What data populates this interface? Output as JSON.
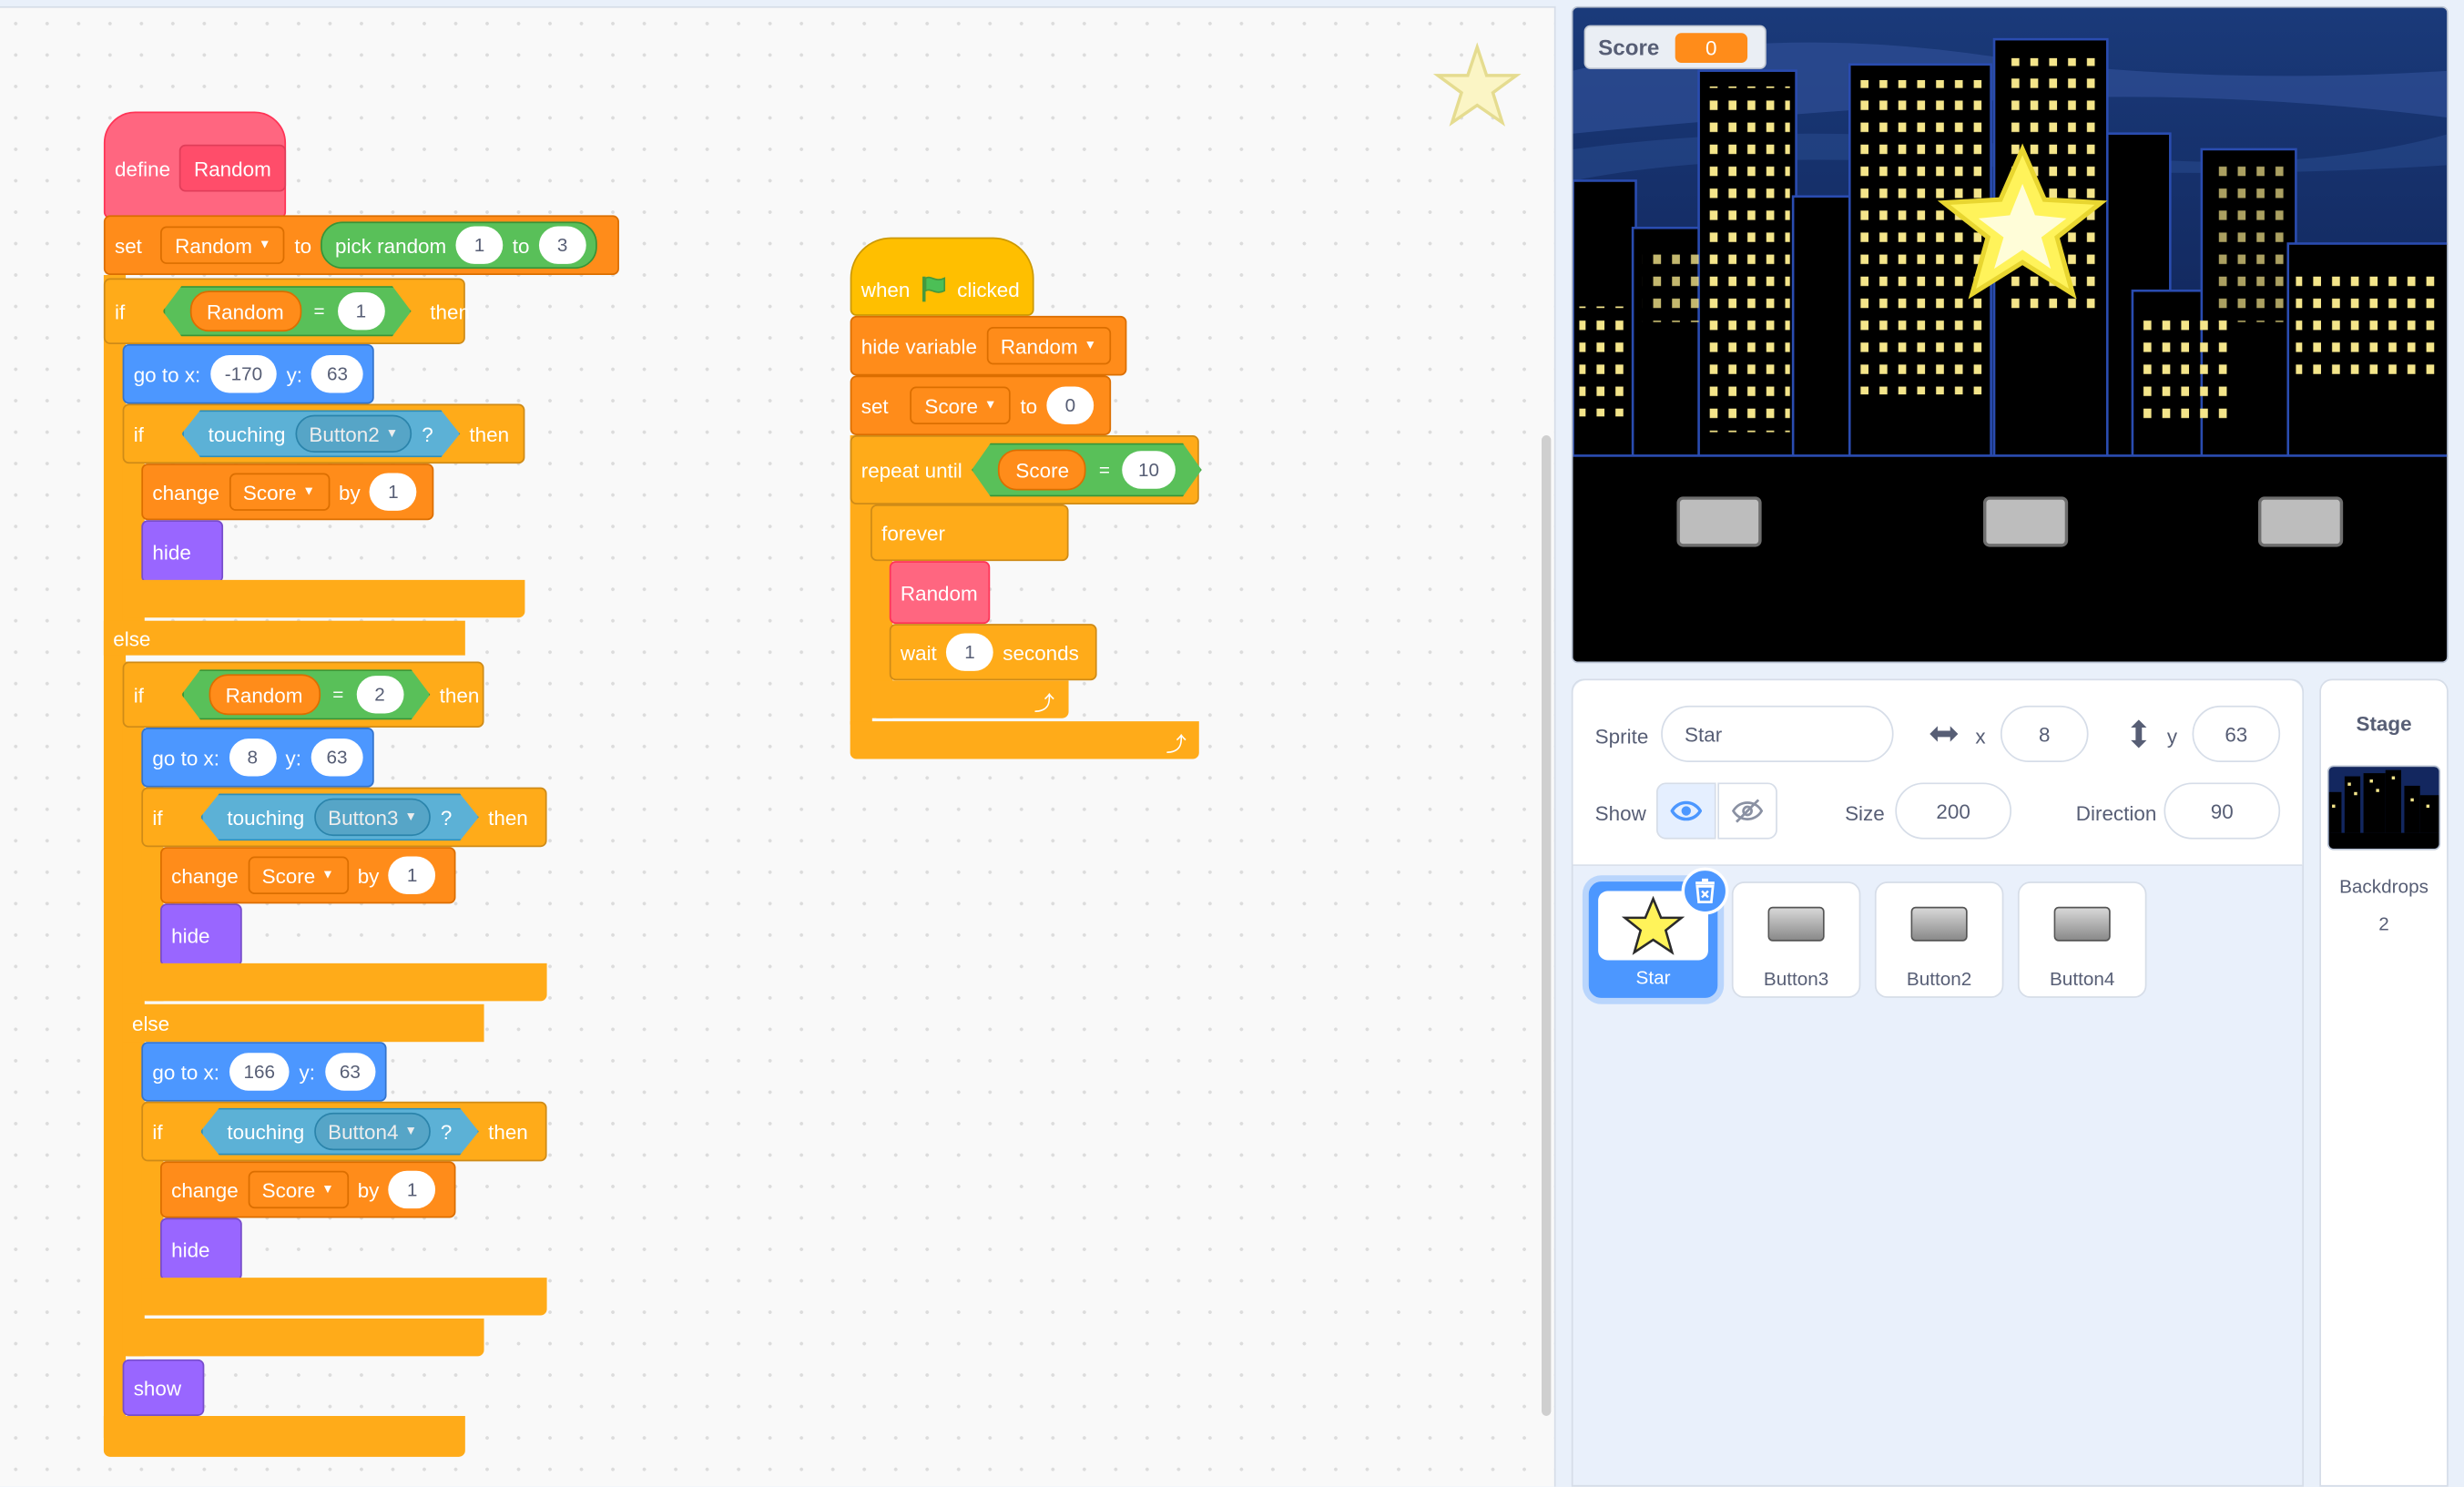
{
  "colors": {
    "motion": "#4c97ff",
    "looks": "#9966ff",
    "events": "#ffbf00",
    "control": "#ffab19",
    "sensing": "#5cb1d6",
    "operators": "#59c059",
    "variables": "#ff8c1a",
    "my_blocks": "#ff6680"
  },
  "define_script": {
    "define_label": "define",
    "proc_name": "Random",
    "set_label": "set",
    "set_var": "Random",
    "to_label": "to",
    "pick_random_label": "pick random",
    "pick_from": "1",
    "pick_to_label": "to",
    "pick_to": "3",
    "branch1": {
      "if_label": "if",
      "cond_var": "Random",
      "eq": "=",
      "cond_value": "1",
      "then_label": "then",
      "goto_label": "go to x:",
      "x": "-170",
      "y_label": "y:",
      "y": "63",
      "touch_if": "if",
      "touching_label": "touching",
      "touch_target": "Button2",
      "q": "?",
      "touch_then": "then",
      "change_label": "change",
      "change_var": "Score",
      "by_label": "by",
      "change_by": "1",
      "hide_label": "hide"
    },
    "else_label": "else",
    "branch2": {
      "if_label": "if",
      "cond_var": "Random",
      "eq": "=",
      "cond_value": "2",
      "then_label": "then",
      "goto_label": "go to x:",
      "x": "8",
      "y_label": "y:",
      "y": "63",
      "touch_if": "if",
      "touching_label": "touching",
      "touch_target": "Button3",
      "q": "?",
      "touch_then": "then",
      "change_label": "change",
      "change_var": "Score",
      "by_label": "by",
      "change_by": "1",
      "hide_label": "hide"
    },
    "else2_label": "else",
    "branch3": {
      "goto_label": "go to x:",
      "x": "166",
      "y_label": "y:",
      "y": "63",
      "touch_if": "if",
      "touching_label": "touching",
      "touch_target": "Button4",
      "q": "?",
      "touch_then": "then",
      "change_label": "change",
      "change_var": "Score",
      "by_label": "by",
      "change_by": "1",
      "hide_label": "hide"
    },
    "show_label": "show"
  },
  "flag_script": {
    "when_label": "when",
    "clicked_label": "clicked",
    "hide_var_label": "hide variable",
    "hide_var": "Random",
    "set_label": "set",
    "set_var": "Score",
    "to_label": "to",
    "set_value": "0",
    "repeat_until_label": "repeat until",
    "cond_var": "Score",
    "eq": "=",
    "cond_value": "10",
    "forever_label": "forever",
    "call_label": "Random",
    "wait_label": "wait",
    "wait_value": "1",
    "seconds_label": "seconds"
  },
  "monitor": {
    "label": "Score",
    "value": "0"
  },
  "sprite_info": {
    "sprite_label": "Sprite",
    "sprite_name": "Star",
    "x_label": "x",
    "x": "8",
    "y_label": "y",
    "y": "63",
    "show_label": "Show",
    "size_label": "Size",
    "size": "200",
    "direction_label": "Direction",
    "direction": "90"
  },
  "sprites": [
    {
      "name": "Star",
      "icon": "star-icon",
      "selected": true
    },
    {
      "name": "Button3",
      "icon": "button-icon",
      "selected": false
    },
    {
      "name": "Button2",
      "icon": "button-icon",
      "selected": false
    },
    {
      "name": "Button4",
      "icon": "button-icon",
      "selected": false
    }
  ],
  "stage_panel": {
    "title": "Stage",
    "backdrops_label": "Backdrops",
    "backdrops_count": "2"
  }
}
